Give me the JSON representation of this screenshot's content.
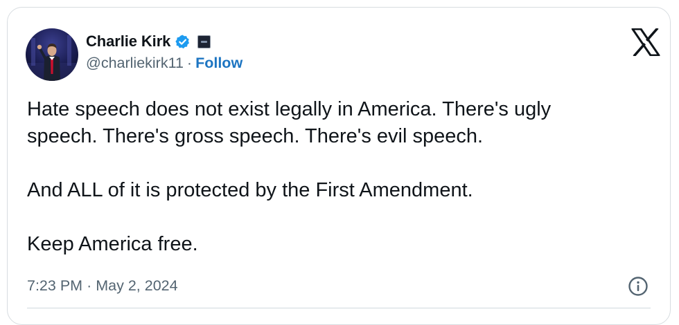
{
  "author": {
    "display_name": "Charlie Kirk",
    "handle": "@charliekirk11",
    "separator": "·",
    "follow_label": "Follow",
    "verified_color": "#1d9bf0",
    "avatar_icon": "person-on-stage-photo",
    "affiliation_icon": "organization-badge-icon"
  },
  "tweet": {
    "lines": [
      "Hate speech does not exist legally in America. There's ugly",
      "speech. There's gross speech. There's evil speech.",
      "And ALL of it is protected by the First Amendment.",
      "Keep America free."
    ]
  },
  "meta": {
    "time": "7:23 PM",
    "separator": "·",
    "date": "May 2, 2024"
  },
  "icons": {
    "platform_logo": "x-logo-icon",
    "info": "info-icon"
  },
  "colors": {
    "text": "#0f1419",
    "secondary": "#536471",
    "follow": "#1d75c2",
    "border": "#d7dce0"
  }
}
